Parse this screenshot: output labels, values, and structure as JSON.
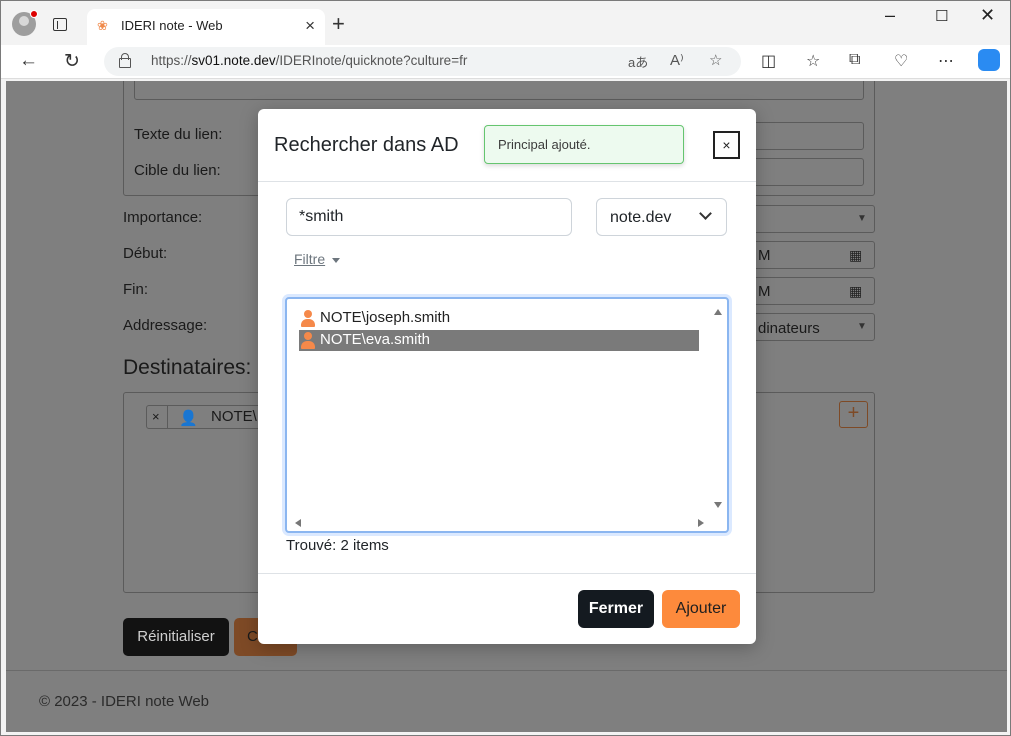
{
  "browser": {
    "tab_title": "IDERI note - Web",
    "url_prefix": "https://",
    "url_host": "sv01.note.dev",
    "url_path": "/IDERInote/quicknote?culture=fr"
  },
  "page": {
    "link_text_label": "Texte du lien:",
    "link_target_label": "Cible du lien:",
    "importance_label": "Importance:",
    "start_label": "Début:",
    "end_label": "Fin:",
    "addressing_label": "Addressage:",
    "addressing_value_partial": "dinateurs",
    "start_time_partial": "M",
    "end_time_partial": "M",
    "recipients_heading": "Destinataires:",
    "recipient_chip_partial": "NOTE\\",
    "reset_button": "Réinitialiser",
    "create_button_partial": "C",
    "footer": "© 2023 - IDERI note Web"
  },
  "modal": {
    "title": "Rechercher dans AD",
    "close_glyph": "×",
    "search_value": "*smith",
    "domain_value": "note.dev",
    "filter_label": "Filtre",
    "results": [
      {
        "text": "NOTE\\joseph.smith",
        "selected": false
      },
      {
        "text": "NOTE\\eva.smith",
        "selected": true
      }
    ],
    "found_text": "Trouvé: 2 items",
    "close_button": "Fermer",
    "add_button": "Ajouter"
  },
  "toast": {
    "message": "Principal ajouté."
  },
  "colors": {
    "accent": "#fd8a3c",
    "dark_button": "#141a20",
    "toast_border": "#65c56f",
    "selection": "#7a7a7a"
  }
}
